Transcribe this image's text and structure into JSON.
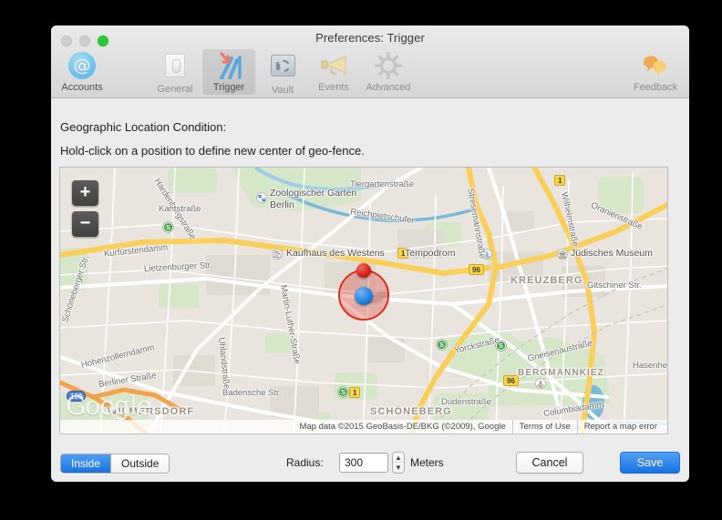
{
  "window": {
    "title": "Preferences: Trigger",
    "traffic_lights": [
      "close",
      "minimize",
      "zoom"
    ]
  },
  "toolbar": {
    "items": [
      {
        "label": "Accounts",
        "icon": "at-sign-icon",
        "selected": false
      },
      {
        "label": "General",
        "icon": "toggle-switch-icon",
        "selected": false
      },
      {
        "label": "Trigger",
        "icon": "trigger-arrow-icon",
        "selected": true
      },
      {
        "label": "Vault",
        "icon": "safe-icon",
        "selected": false
      },
      {
        "label": "Events",
        "icon": "megaphone-icon",
        "selected": false
      },
      {
        "label": "Advanced",
        "icon": "gear-icon",
        "selected": false
      }
    ],
    "feedback": {
      "label": "Feedback",
      "icon": "speech-bubbles-icon"
    }
  },
  "main": {
    "section_title": "Geographic Location Condition:",
    "hint": "Hold-click on a position to define new center of geo-fence."
  },
  "map": {
    "zoom_in_label": "+",
    "zoom_out_label": "−",
    "watermark": "Google",
    "attribution": {
      "data": "Map data ©2015 GeoBasis-DE/BKG (©2009), Google",
      "terms": "Terms of Use",
      "report": "Report a map error"
    },
    "streets": [
      "Hardenbergstraße",
      "Kantstraße",
      "Kurfürstendamm",
      "Lietzenburger Str.",
      "Tiergartenstraße",
      "Reichpietschufer",
      "Oranienstraße",
      "Gitschiner Str.",
      "Wilhelmstraße",
      "Martin-Luther-Straße",
      "Yorckstraße",
      "Gneisenaustraße",
      "Hohenzollerndamm",
      "Berliner Straße",
      "Uhlandstraße",
      "Badensche Str.",
      "Dudenstraße",
      "Columbiadamm",
      "Hasenheide",
      "Stresemannstraße",
      "Schöneberger Str."
    ],
    "pois": [
      "Zoologischer Garten Berlin",
      "Kaufhaus des Westens",
      "Tempodrom",
      "Jüdisches Museum"
    ],
    "districts": [
      "WILMERSDORF",
      "SCHÖNEBERG",
      "KREUZBERG",
      "BERGMANNKIEZ"
    ],
    "route_shields": [
      "1",
      "96",
      "100",
      "1",
      "96"
    ],
    "marker": {
      "type": "geofence-pin",
      "color": "#e02a1c",
      "center_color": "#1f7fe0"
    }
  },
  "controls": {
    "segmented": {
      "options": [
        "Inside",
        "Outside"
      ],
      "selected": "Inside"
    },
    "radius_label": "Radius:",
    "radius_value": "300",
    "units_label": "Meters",
    "stepper_up": "▲",
    "stepper_down": "▼",
    "cancel_label": "Cancel",
    "save_label": "Save"
  },
  "colors": {
    "accent": "#1773e0",
    "geofence": "#e02a1c",
    "window_bg": "#ececec"
  }
}
